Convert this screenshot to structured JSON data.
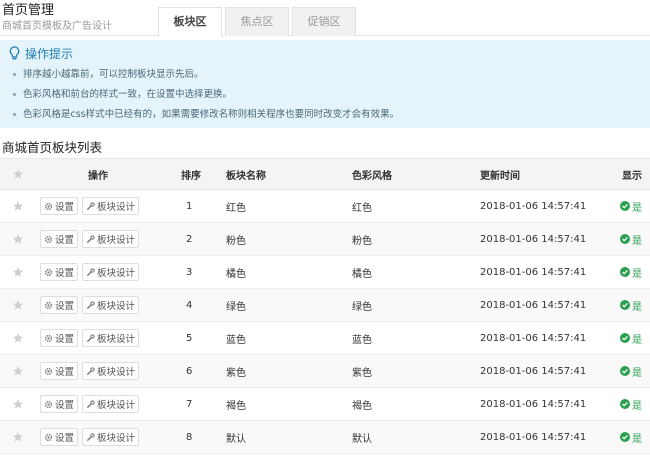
{
  "header": {
    "title": "首页管理",
    "subtitle": "商城首页模板及广告设计",
    "tabs": [
      {
        "label": "板块区",
        "active": true
      },
      {
        "label": "焦点区",
        "active": false
      },
      {
        "label": "促销区",
        "active": false
      }
    ]
  },
  "tips": {
    "title": "操作提示",
    "icon": "bulb-icon",
    "items": [
      "排序越小越靠前，可以控制板块显示先后。",
      "色彩风格和前台的样式一致，在设置中选择更换。",
      "色彩风格是css样式中已经有的，如果需要修改名称则相关程序也要同时改变才会有效果。"
    ]
  },
  "section_title": "商城首页板块列表",
  "table": {
    "columns": [
      "",
      "操作",
      "排序",
      "板块名称",
      "色彩风格",
      "更新时间",
      "显示"
    ],
    "buttons": {
      "settings": "设置",
      "design": "板块设计"
    },
    "rows": [
      {
        "sort": "1",
        "name": "红色",
        "color": "红色",
        "time": "2018-01-06 14:57:41",
        "show": "是"
      },
      {
        "sort": "2",
        "name": "粉色",
        "color": "粉色",
        "time": "2018-01-06 14:57:41",
        "show": "是"
      },
      {
        "sort": "3",
        "name": "橘色",
        "color": "橘色",
        "time": "2018-01-06 14:57:41",
        "show": "是"
      },
      {
        "sort": "4",
        "name": "绿色",
        "color": "绿色",
        "time": "2018-01-06 14:57:41",
        "show": "是"
      },
      {
        "sort": "5",
        "name": "蓝色",
        "color": "蓝色",
        "time": "2018-01-06 14:57:41",
        "show": "是"
      },
      {
        "sort": "6",
        "name": "紫色",
        "color": "紫色",
        "time": "2018-01-06 14:57:41",
        "show": "是"
      },
      {
        "sort": "7",
        "name": "褐色",
        "color": "褐色",
        "time": "2018-01-06 14:57:41",
        "show": "是"
      },
      {
        "sort": "8",
        "name": "默认",
        "color": "默认",
        "time": "2018-01-06 14:57:41",
        "show": "是"
      }
    ]
  },
  "colors": {
    "accent": "#1e7fb8",
    "tips_bg": "#e5f3fa",
    "ok": "#2a9f4f",
    "star": "#cfcfcf"
  }
}
